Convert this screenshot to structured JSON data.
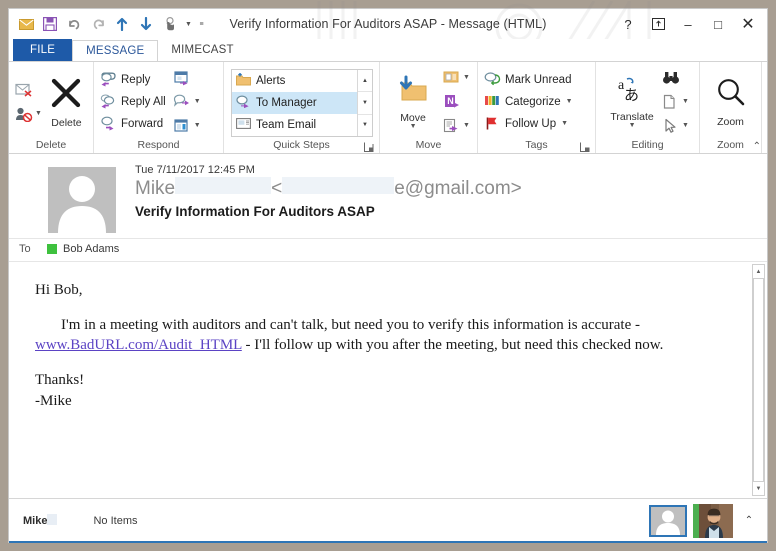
{
  "window": {
    "title": "Verify Information For Auditors ASAP - Message (HTML)",
    "help_label": "?",
    "restore_down_label": "⍐",
    "minimize_label": "–",
    "maximize_label": "□",
    "close_label": "✕",
    "accent_blue": "#1e5aa8",
    "presence_green": "#3ec13e",
    "link_purple": "#5b43c4"
  },
  "quick_access": {
    "items": [
      {
        "name": "mail-icon",
        "label": "Mail"
      },
      {
        "name": "save-icon",
        "label": "Save"
      },
      {
        "name": "undo-icon",
        "label": "Undo"
      },
      {
        "name": "redo-icon",
        "label": "Redo"
      },
      {
        "name": "previous-item-icon",
        "label": "Previous Item"
      },
      {
        "name": "next-item-icon",
        "label": "Next Item"
      },
      {
        "name": "touch-mode-icon",
        "label": "Touch/Mouse Mode"
      },
      {
        "name": "customize-qat-icon",
        "label": "Customize Quick Access Toolbar"
      }
    ]
  },
  "tabs": [
    {
      "id": "file",
      "label": "FILE"
    },
    {
      "id": "message",
      "label": "MESSAGE"
    },
    {
      "id": "mimecast",
      "label": "MIMECAST"
    }
  ],
  "ribbon": {
    "collapse_label": "⌃",
    "groups": [
      {
        "id": "delete",
        "label": "Delete",
        "buttons": [
          {
            "label": "Ignore",
            "icon": "ignore-icon"
          },
          {
            "label": "Junk",
            "icon": "junk-icon"
          },
          {
            "label": "Delete",
            "icon": "delete-x-icon"
          }
        ]
      },
      {
        "id": "respond",
        "label": "Respond",
        "buttons": [
          {
            "label": "Reply",
            "icon": "reply-icon"
          },
          {
            "label": "Reply All",
            "icon": "reply-all-icon"
          },
          {
            "label": "Forward",
            "icon": "forward-icon"
          },
          {
            "label": "Meeting",
            "icon": "meeting-icon"
          },
          {
            "label": "IM",
            "icon": "im-icon"
          },
          {
            "label": "More",
            "icon": "more-respond-icon"
          }
        ]
      },
      {
        "id": "quick-steps",
        "label": "Quick Steps",
        "items": [
          {
            "label": "Alerts",
            "icon": "folder-alert-icon",
            "selected": false
          },
          {
            "label": "To Manager",
            "icon": "to-manager-icon",
            "selected": true
          },
          {
            "label": "Team Email",
            "icon": "team-email-icon",
            "selected": false
          }
        ],
        "dialog_launcher": "⬎"
      },
      {
        "id": "move",
        "label": "Move",
        "buttons": [
          {
            "label": "Move",
            "icon": "move-folder-icon"
          },
          {
            "label": "Rules",
            "icon": "rules-icon"
          },
          {
            "label": "OneNote",
            "icon": "onenote-icon"
          },
          {
            "label": "Actions",
            "icon": "actions-icon"
          }
        ]
      },
      {
        "id": "tags",
        "label": "Tags",
        "buttons": [
          {
            "label": "Mark Unread",
            "icon": "mark-unread-icon"
          },
          {
            "label": "Categorize",
            "icon": "categorize-icon"
          },
          {
            "label": "Follow Up",
            "icon": "follow-up-flag-icon"
          }
        ],
        "dialog_launcher": "⬎"
      },
      {
        "id": "editing",
        "label": "Editing",
        "buttons": [
          {
            "label": "Translate",
            "icon": "translate-icon"
          },
          {
            "label": "Find",
            "icon": "find-binoculars-icon"
          },
          {
            "label": "Related",
            "icon": "related-document-icon"
          },
          {
            "label": "Select",
            "icon": "select-cursor-icon"
          }
        ]
      },
      {
        "id": "zoom",
        "label": "Zoom",
        "buttons": [
          {
            "label": "Zoom",
            "icon": "zoom-magnifier-icon"
          }
        ]
      }
    ]
  },
  "message": {
    "date": "Tue 7/11/2017 12:45 PM",
    "from_name": "Mike",
    "from_redacted_name": "",
    "from_bracket_open": "<",
    "from_address_tail": "e@gmail.com>",
    "subject": "Verify Information For Auditors ASAP",
    "to_label": "To",
    "to_recipient": "Bob Adams",
    "sender_avatar": "generic-person-avatar"
  },
  "body": {
    "greeting": "Hi Bob,",
    "paragraph_before_link": "I'm in a meeting with auditors and can't talk, but need you to verify this information is accurate - ",
    "link_text": "www.BadURL.com/Audit_HTML",
    "paragraph_after_link": " - I'll follow up with you after the meeting, but need this checked now.",
    "closing": "Thanks!",
    "signature": "-Mike"
  },
  "scrollbar": {
    "up_label": "▲",
    "down_label": "▼"
  },
  "status_bar": {
    "name": "Mike",
    "items_text": "No Items",
    "chevron_label": "⌃",
    "people_cards": [
      {
        "name": "people-pane-placeholder-avatar"
      },
      {
        "name": "people-pane-contact-photo"
      }
    ]
  }
}
